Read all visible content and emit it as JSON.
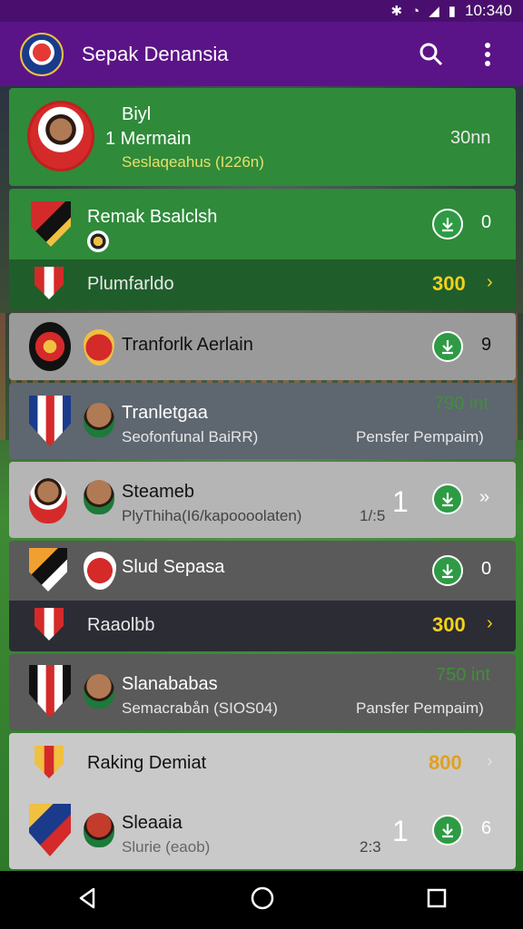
{
  "status": {
    "time": "10:340"
  },
  "appbar": {
    "title": "Sepak Denansia",
    "search_icon": "search-icon",
    "menu_icon": "more-vert-icon"
  },
  "rows": [
    {
      "name_top": "Biyl",
      "name": "1 Mermain",
      "sub": "Seslaqeahus (I226n)",
      "side": "30nn"
    },
    {
      "name": "Remak Bsalclsh",
      "side": "0"
    },
    {
      "name": "Plumfarldo",
      "value": "300"
    },
    {
      "name": "Tranforlk Aerlain",
      "side": "9"
    },
    {
      "name": "Tranletgaa",
      "sub": "Seofonfunal BaiRR)",
      "side_top": "790 int",
      "side_sub": "Pensfer Pempaim)"
    },
    {
      "name": "Steameb",
      "sub": "PlyThiha(I6/kapoooolaten)",
      "count_small": "1/:5",
      "count": "1",
      "side": "»"
    },
    {
      "name": "Slud Sepasa",
      "side": "0"
    },
    {
      "name": "Raaolbb",
      "value": "300"
    },
    {
      "name": "Slanababas",
      "sub": "Semacrabån (SIOS04)",
      "side_top": "750 int",
      "side_sub": "Pansfer Pempaim)"
    },
    {
      "name": "Raking Demiat",
      "value": "800"
    },
    {
      "name": "Sleaaia",
      "sub": "Slurie (eaob)",
      "count_small": "2:3",
      "count": "1",
      "side": "6"
    }
  ]
}
